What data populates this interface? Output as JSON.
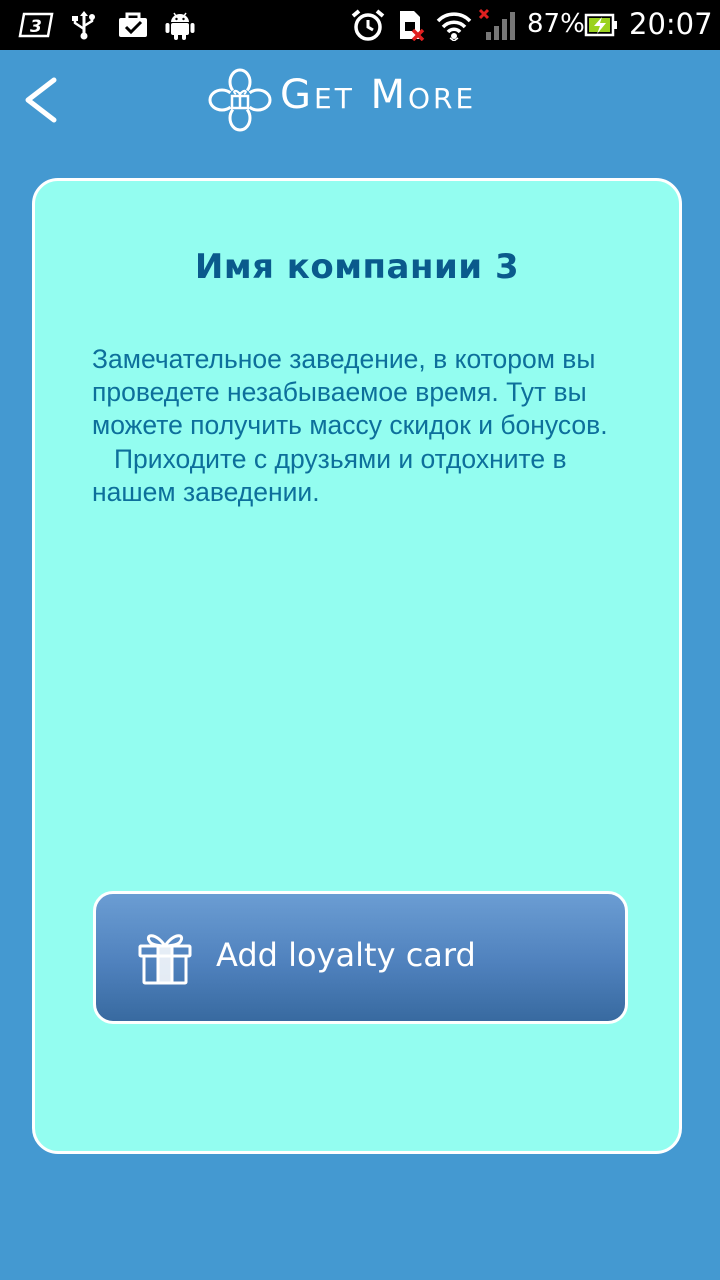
{
  "status_bar": {
    "battery_percent": "87%",
    "time": "20:07",
    "icons": [
      "3g-icon",
      "usb-icon",
      "briefcase-check-icon",
      "android-icon",
      "alarm-icon",
      "sim-error-icon",
      "wifi-icon",
      "signal-no-service-icon",
      "battery-charging-icon"
    ]
  },
  "app_bar": {
    "title": "Get More",
    "back_icon": "chevron-left-icon",
    "logo_icon": "flower-gift-icon"
  },
  "card": {
    "company_name": "Имя компании 3",
    "description_p1": "Замечательное заведение, в котором вы проведете незабываемое время. Тут вы можете получить массу скидок и бонусов.",
    "description_p2": "Приходите с друзьями и отдохните в нашем заведении.",
    "button_label": "Add loyalty card",
    "button_icon": "gift-icon"
  },
  "colors": {
    "background": "#4499d1",
    "card": "#93fdf0",
    "title_text": "#0a5a8c",
    "body_text": "#0d6f9b",
    "button": "#4f81bd"
  }
}
